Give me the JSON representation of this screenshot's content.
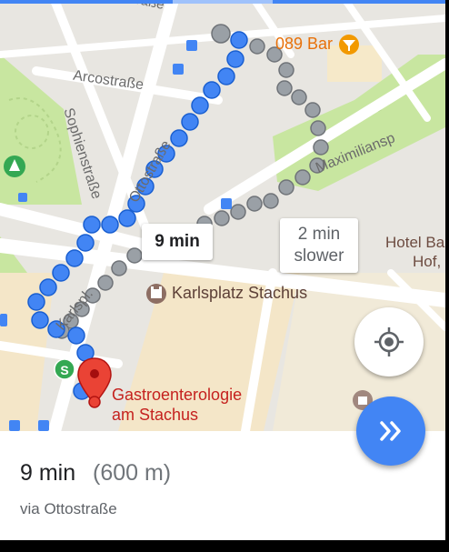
{
  "map": {
    "streets": {
      "top_partial": "raße",
      "arcostrasse": "Arcostraße",
      "sophienstrasse": "Sophienstraße",
      "ottostrasse": "Ottostraße",
      "maximiliansplatz": "Maximiliansp",
      "karlspl": "Karlspl."
    },
    "pois": {
      "bar": "089 Bar",
      "karlsplatz": "Karlsplatz Stachus",
      "hotel_line1": "Hotel Ba",
      "hotel_line2": "Hof,",
      "destination_line1": "Gastroenterologie",
      "destination_line2": "am Stachus"
    },
    "route_callout": "9 min",
    "alt_callout_line1": "2 min",
    "alt_callout_line2": "slower"
  },
  "bottom_sheet": {
    "time": "9 min",
    "distance": "(600 m)",
    "via": "via Ottostraße"
  },
  "colors": {
    "route_primary": "#4285f4",
    "route_alternative": "#9aa0a6",
    "park": "#c8e6a0",
    "destination_pin": "#ea4335",
    "bar_marker": "#f29900",
    "go_button": "#4285f4"
  },
  "icons": {
    "locate": "my-location-icon",
    "go": "double-chevron-right-icon",
    "destination": "red-pin-icon"
  }
}
